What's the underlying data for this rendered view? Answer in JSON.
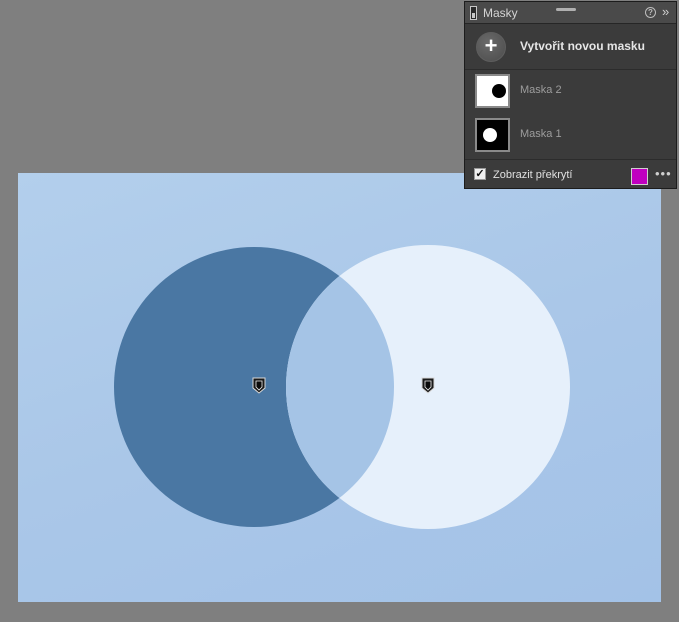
{
  "panel": {
    "title": "Masky",
    "help_glyph": "?",
    "expand_glyph": "»",
    "create_glyph": "+",
    "create_label": "Vytvořit novou masku",
    "masks": [
      {
        "label": "Maska 2",
        "thumb_bg": "#ffffff",
        "thumb_dot": "#000000",
        "selected": false
      },
      {
        "label": "Maska 1",
        "thumb_bg": "#000000",
        "thumb_dot": "#ffffff",
        "selected": false
      }
    ],
    "overlay_checkbox": {
      "checked": true,
      "glyph": "✓",
      "label": "Zobrazit překrytí"
    },
    "overlay_color": "#c000c0",
    "more_glyph": "•••"
  },
  "colors": {
    "background": "#7f7f7f",
    "photo": "#aac8e9",
    "mask_dark": "#4a77a3",
    "mask_light": "#e6f0fb",
    "overlap": "#a5c4e6"
  }
}
